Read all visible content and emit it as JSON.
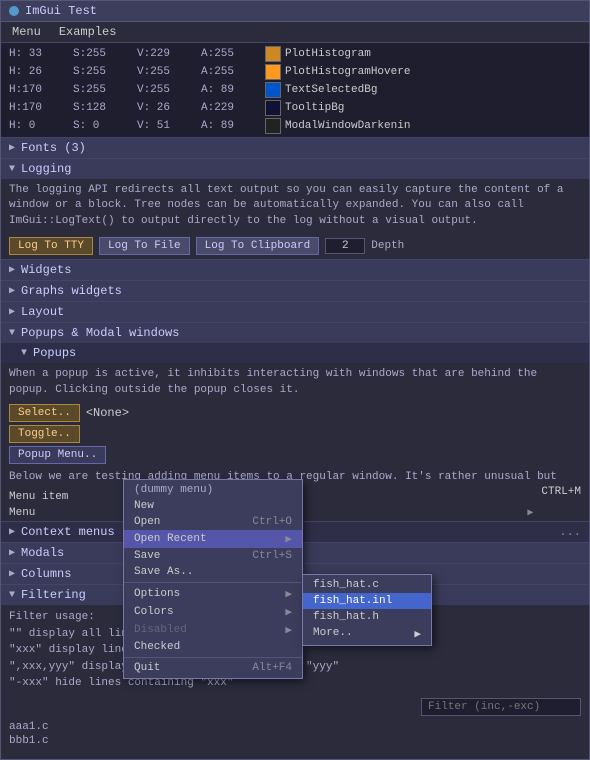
{
  "window": {
    "title": "ImGui Test",
    "menu": [
      "Menu",
      "Examples"
    ]
  },
  "color_table": {
    "rows": [
      {
        "h": "H: 33",
        "s": "S:255",
        "v": "V:229",
        "a": "A:255",
        "label": "PlotHistogram",
        "color": "#cc8822"
      },
      {
        "h": "H: 26",
        "s": "S:255",
        "v": "V:255",
        "a": "A:255",
        "label": "PlotHistogramHovere",
        "color": "#ff9922"
      },
      {
        "h": "H:170",
        "s": "S:255",
        "v": "V:255",
        "a": "A: 89",
        "label": "TextSelectedBg",
        "color": "#0055cc"
      },
      {
        "h": "H:170",
        "s": "S:128",
        "v": "V: 26",
        "a": "A:229",
        "label": "TooltipBg",
        "color": "#111133"
      },
      {
        "h": "H:  0",
        "s": "S:  0",
        "v": "V: 51",
        "a": "A: 89",
        "label": "ModalWindowDarkenin",
        "color": "#222222"
      }
    ]
  },
  "fonts_section": {
    "label": "Fonts (3)",
    "collapsed": true
  },
  "logging_section": {
    "label": "Logging",
    "expanded": true,
    "description": "The logging API redirects all text output so you can easily capture the content of a window or a block. Tree nodes can be automatically expanded. You can also call ImGui::LogText() to output directly to the log without a visual output.",
    "btn_tty": "Log To TTY",
    "btn_file": "Log To File",
    "btn_clipboard": "Log To Clipboard",
    "depth_value": "2",
    "depth_label": "Depth"
  },
  "sections": [
    {
      "label": "Widgets",
      "expanded": false
    },
    {
      "label": "Graphs widgets",
      "expanded": false
    },
    {
      "label": "Layout",
      "expanded": false
    }
  ],
  "popups_section": {
    "label": "Popups & Modal windows",
    "expanded": true,
    "sub_label": "Popups",
    "description": "When a popup is active, it inhibits interacting with windows that are behind the popup. Clicking outside the popup closes it.",
    "btn_select": "Select..",
    "none_label": "<None>",
    "btn_toggle": "Toggle..",
    "btn_popup": "Popup Menu..",
    "below_text": "Below we are testing adding menu items to a regular window. It's rather unusual but",
    "shortcut_label": "CTRL+M",
    "menu_items": [
      {
        "label": "Menu item",
        "value": ""
      },
      {
        "label": "Menu",
        "value": "",
        "has_arrow": true
      }
    ]
  },
  "context_menu": {
    "header": "(dummy menu)",
    "items": [
      {
        "label": "New",
        "shortcut": "",
        "has_submenu": false,
        "disabled": false
      },
      {
        "label": "Open",
        "shortcut": "Ctrl+O",
        "has_submenu": false,
        "disabled": false
      },
      {
        "label": "Open Recent",
        "shortcut": "",
        "has_submenu": true,
        "disabled": false,
        "selected": false
      },
      {
        "label": "Save",
        "shortcut": "Ctrl+S",
        "has_submenu": false,
        "disabled": false
      },
      {
        "label": "Save As..",
        "shortcut": "",
        "has_submenu": false,
        "disabled": false
      },
      {
        "label": "Options",
        "shortcut": "",
        "has_submenu": true,
        "disabled": false
      },
      {
        "label": "Colors",
        "shortcut": "",
        "has_submenu": true,
        "disabled": false
      },
      {
        "label": "Disabled",
        "shortcut": "",
        "has_submenu": true,
        "disabled": true
      },
      {
        "label": "Checked",
        "shortcut": "",
        "has_submenu": false,
        "disabled": false
      },
      {
        "label": "Quit",
        "shortcut": "Alt+F4",
        "has_submenu": false,
        "disabled": false
      }
    ],
    "submenu": {
      "items": [
        {
          "label": "fish_hat.c",
          "selected": false
        },
        {
          "label": "fish_hat.inl",
          "selected": true
        },
        {
          "label": "fish_hat.h",
          "selected": false
        },
        {
          "label": "More..",
          "selected": false,
          "has_arrow": true
        }
      ]
    }
  },
  "context_sub_sections": [
    {
      "label": "Modals",
      "expanded": false
    },
    {
      "label": "Columns",
      "expanded": false
    }
  ],
  "filtering_section": {
    "label": "Filtering",
    "expanded": true,
    "lines": [
      "Filter usage:",
      "\"\"          display all lines",
      "\"xxx\"       display lines containing \"xxx\"",
      "\",xxx,yyy\"  display lines containing \"xxx\" or \"yyy\"",
      "\"-xxx\"      hide lines containing \"xxx\""
    ],
    "filter_placeholder": "Filter (inc,-exc)"
  },
  "file_list": [
    {
      "name": "aaa1.c"
    },
    {
      "name": "bbb1.c"
    }
  ]
}
